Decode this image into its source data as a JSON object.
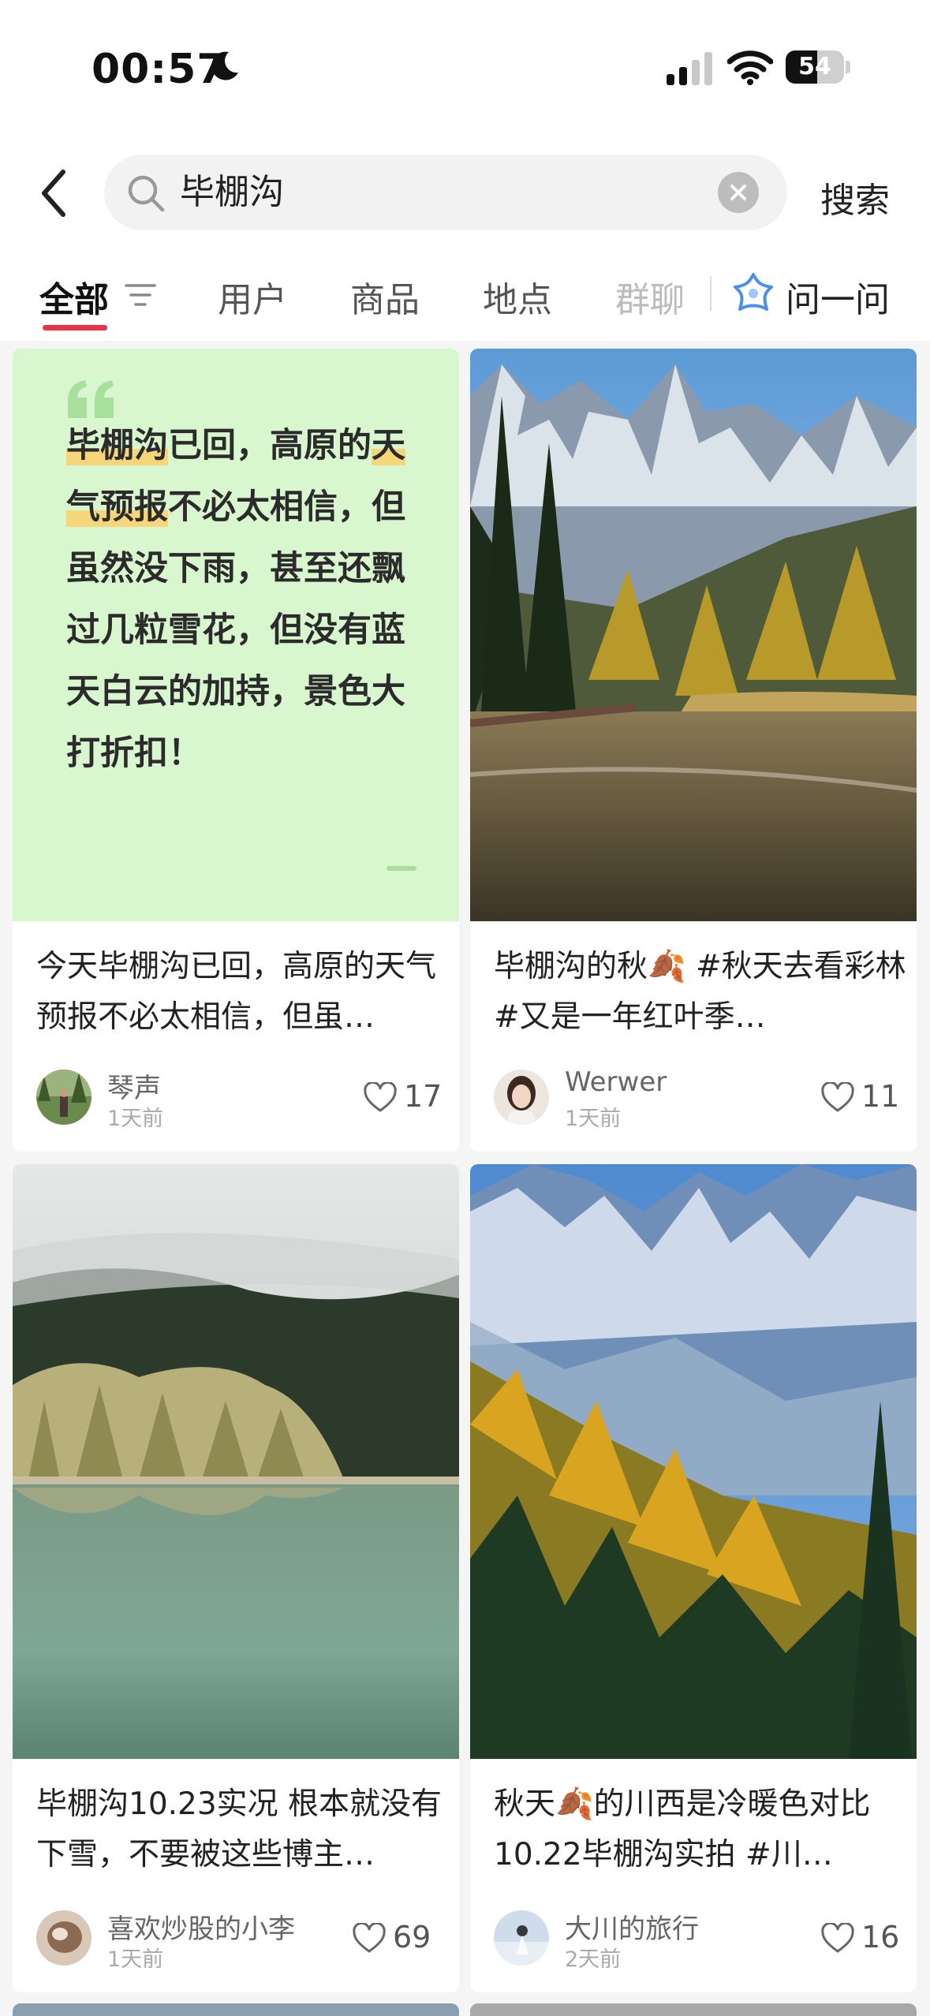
{
  "status_bar": {
    "time": "00:57",
    "battery": "54",
    "battery_level": 0.54
  },
  "search": {
    "query": "毕棚沟",
    "submit_label": "搜索"
  },
  "tabs": [
    {
      "label": "全部",
      "active": true
    },
    {
      "label": "用户"
    },
    {
      "label": "商品"
    },
    {
      "label": "地点"
    },
    {
      "label": "群聊"
    },
    {
      "label": "问一问"
    }
  ],
  "icons": [
    "back-icon",
    "search-icon",
    "clear-icon",
    "filter-icon",
    "ask-ai-icon",
    "heart-icon",
    "quote-icon",
    "moon-icon",
    "signal-icon",
    "wifi-icon",
    "battery-icon"
  ],
  "colors": {
    "accent": "#e8334a",
    "quote_bg": "#d9f7cf",
    "highlight": "#f5d67a"
  },
  "feed": [
    {
      "quote_parts": [
        "毕棚沟",
        "已回，高原的",
        "天气预报",
        "不必太相信，但虽然没下雨，甚至还飘过几粒雪花，但没有蓝天白云的加持，景色大打折扣！"
      ],
      "title": "今天毕棚沟已回，高原的天气预报不必太相信，但虽…",
      "author": "琴声",
      "time": "1天前",
      "likes": "17"
    },
    {
      "title": "毕棚沟的秋🍂 #秋天去看彩林 #又是一年红叶季…",
      "author": "Werwer",
      "time": "1天前",
      "likes": "11"
    },
    {
      "title": "毕棚沟10.23实况 根本就没有下雪，不要被这些博主…",
      "author": "喜欢炒股的小李",
      "time": "1天前",
      "likes": "69"
    },
    {
      "title": "秋天🍂的川西是冷暖色对比 10.22毕棚沟实拍 #川…",
      "author": "大川的旅行",
      "time": "2天前",
      "likes": "16"
    }
  ]
}
